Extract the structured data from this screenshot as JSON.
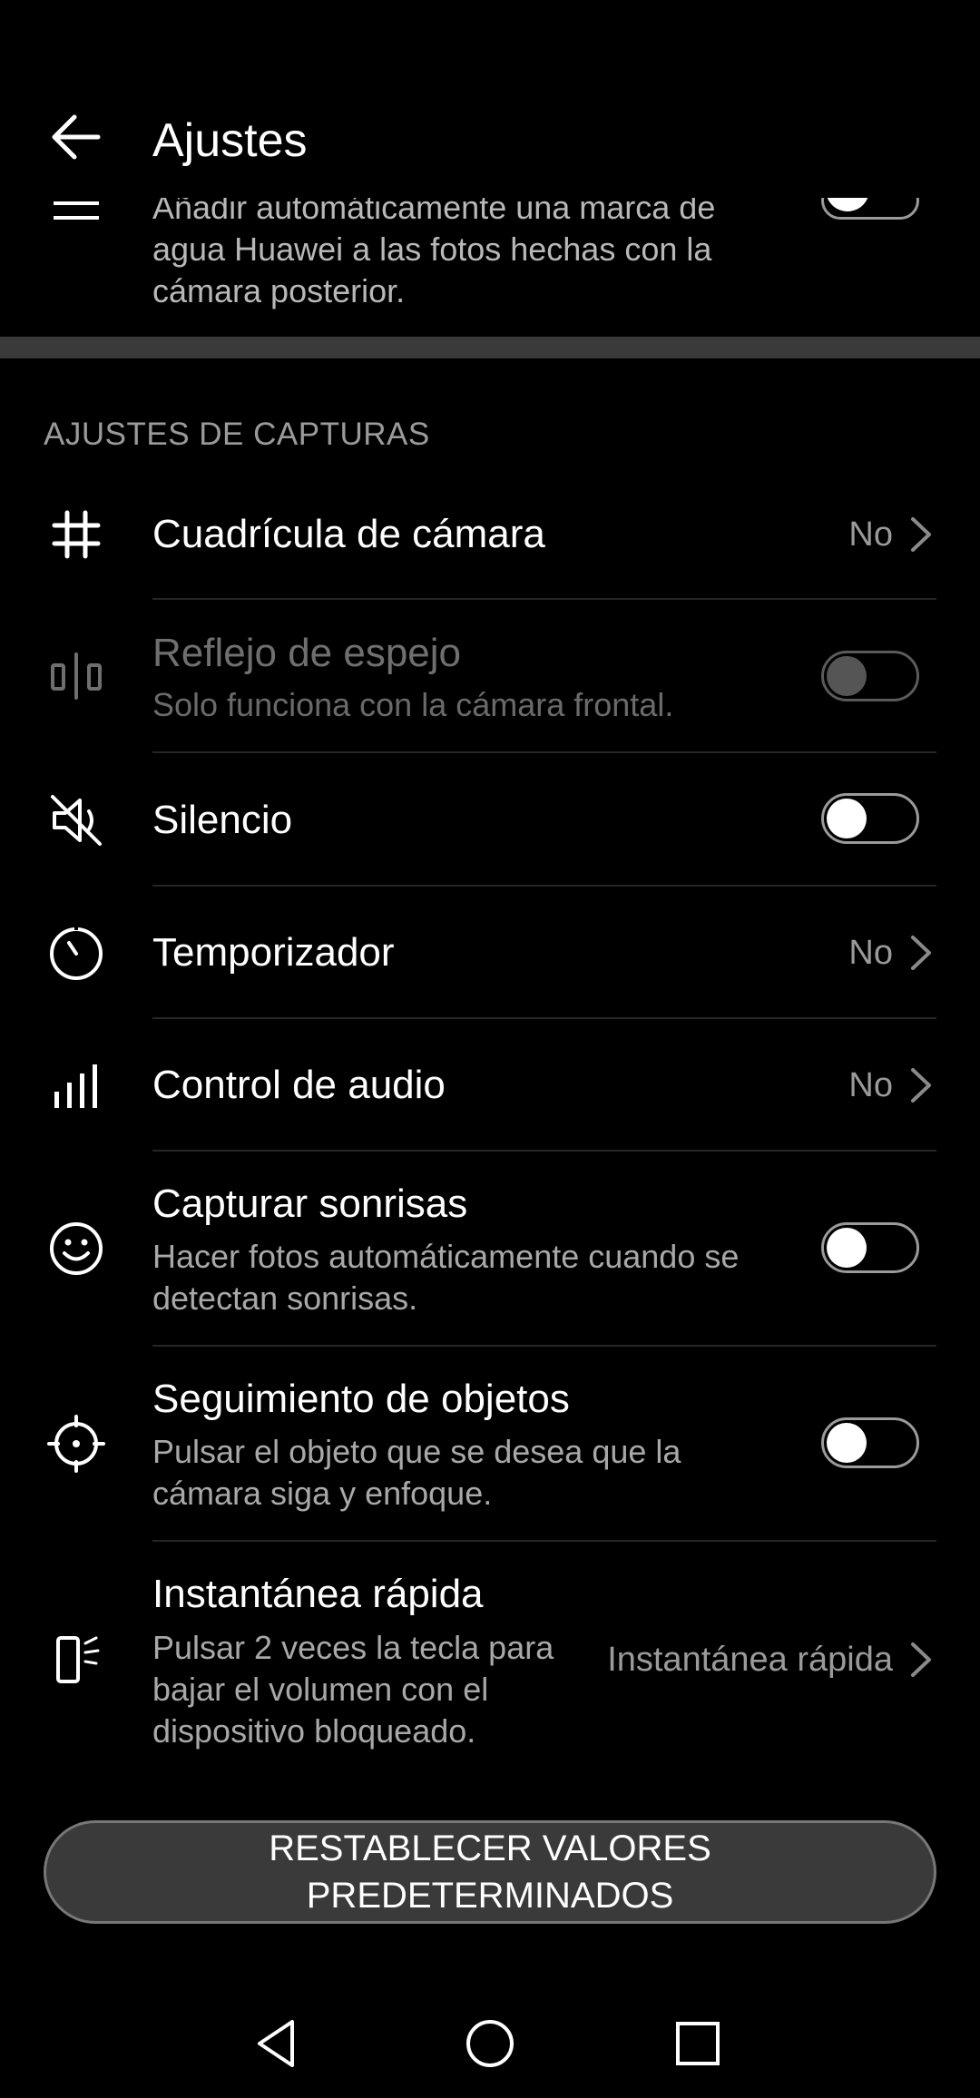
{
  "header": {
    "title": "Ajustes",
    "back_icon": "arrow-left-icon"
  },
  "partial_item": {
    "text": "Añadir automáticamente una marca de agua Huawei a las fotos hechas con la cámara posterior.",
    "icon": "watermark-icon",
    "toggle_on": false
  },
  "section": {
    "title": "AJUSTES DE CAPTURAS"
  },
  "items": [
    {
      "title": "Cuadrícula de cámara",
      "value": "No",
      "icon": "grid-icon",
      "control": "chevron"
    },
    {
      "title": "Reflejo de espejo",
      "subtitle": "Solo funciona con la cámara frontal.",
      "icon": "mirror-icon",
      "control": "toggle",
      "toggle_on": false,
      "disabled": true
    },
    {
      "title": "Silencio",
      "icon": "mute-icon",
      "control": "toggle",
      "toggle_on": false
    },
    {
      "title": "Temporizador",
      "value": "No",
      "icon": "timer-icon",
      "control": "chevron"
    },
    {
      "title": "Control de audio",
      "value": "No",
      "icon": "audio-bars-icon",
      "control": "chevron"
    },
    {
      "title": "Capturar sonrisas",
      "subtitle": "Hacer fotos automáticamente cuando se detectan sonrisas.",
      "icon": "smile-icon",
      "control": "toggle",
      "toggle_on": false
    },
    {
      "title": "Seguimiento de objetos",
      "subtitle": "Pulsar el objeto que se desea que la cámara siga y enfoque.",
      "icon": "crosshair-icon",
      "control": "toggle",
      "toggle_on": false
    },
    {
      "title": "Instantánea rápida",
      "subtitle": "Pulsar 2 veces la tecla para bajar el volumen con el dispositivo bloqueado.",
      "value": "Instantánea rápida",
      "icon": "quick-snap-icon",
      "control": "chevron"
    }
  ],
  "reset_button": {
    "label": "RESTABLECER VALORES PREDETERMINADOS"
  },
  "nav_bar": {
    "back": "nav-back-icon",
    "home": "nav-home-icon",
    "recents": "nav-recents-icon"
  }
}
